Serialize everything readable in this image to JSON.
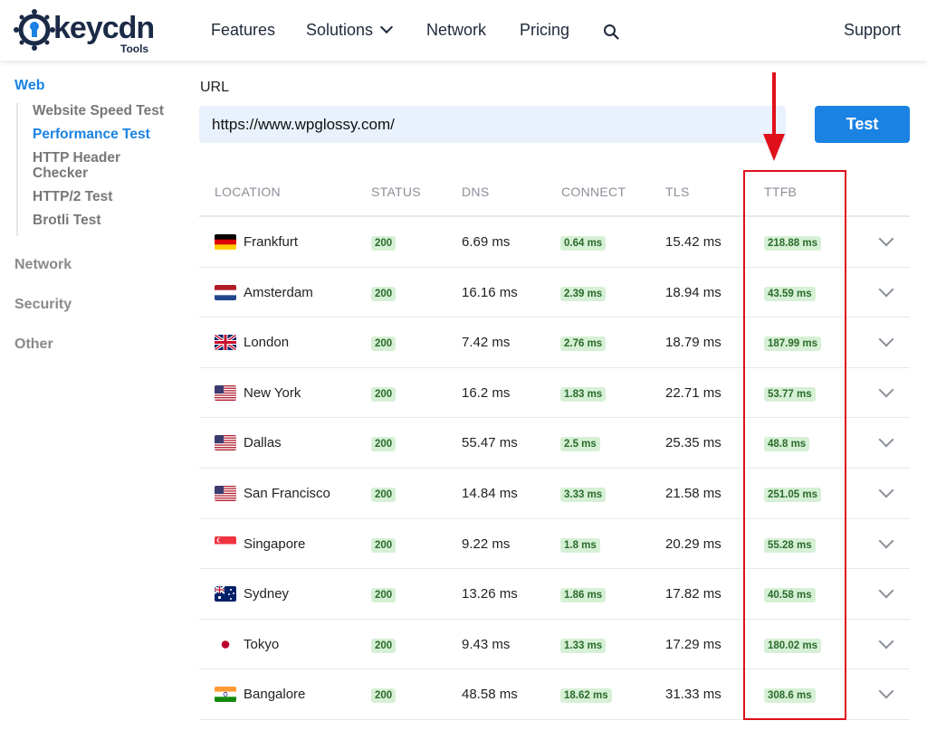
{
  "header": {
    "logo_text": "keycdn",
    "logo_sub": "Tools",
    "nav": {
      "features": "Features",
      "solutions": "Solutions",
      "network": "Network",
      "pricing": "Pricing",
      "support": "Support"
    }
  },
  "sidebar": {
    "web_label": "Web",
    "web_items": [
      {
        "label": "Website Speed Test",
        "active": false
      },
      {
        "label": "Performance Test",
        "active": true
      },
      {
        "label": "HTTP Header Checker",
        "active": false
      },
      {
        "label": "HTTP/2 Test",
        "active": false
      },
      {
        "label": "Brotli Test",
        "active": false
      }
    ],
    "network_label": "Network",
    "security_label": "Security",
    "other_label": "Other"
  },
  "form": {
    "url_label": "URL",
    "url_value": "https://www.wpglossy.com/",
    "test_button": "Test"
  },
  "table": {
    "columns": [
      "LOCATION",
      "STATUS",
      "DNS",
      "CONNECT",
      "TLS",
      "TTFB"
    ],
    "rows": [
      {
        "location": "Frankfurt",
        "flag": "de",
        "status": "200",
        "dns": "6.69 ms",
        "connect": "0.64 ms",
        "tls": "15.42 ms",
        "ttfb": "218.88 ms"
      },
      {
        "location": "Amsterdam",
        "flag": "nl",
        "status": "200",
        "dns": "16.16 ms",
        "connect": "2.39 ms",
        "tls": "18.94 ms",
        "ttfb": "43.59 ms"
      },
      {
        "location": "London",
        "flag": "gb",
        "status": "200",
        "dns": "7.42 ms",
        "connect": "2.76 ms",
        "tls": "18.79 ms",
        "ttfb": "187.99 ms"
      },
      {
        "location": "New York",
        "flag": "us",
        "status": "200",
        "dns": "16.2 ms",
        "connect": "1.83 ms",
        "tls": "22.71 ms",
        "ttfb": "53.77 ms"
      },
      {
        "location": "Dallas",
        "flag": "us",
        "status": "200",
        "dns": "55.47 ms",
        "connect": "2.5 ms",
        "tls": "25.35 ms",
        "ttfb": "48.8 ms"
      },
      {
        "location": "San Francisco",
        "flag": "us",
        "status": "200",
        "dns": "14.84 ms",
        "connect": "3.33 ms",
        "tls": "21.58 ms",
        "ttfb": "251.05 ms"
      },
      {
        "location": "Singapore",
        "flag": "sg",
        "status": "200",
        "dns": "9.22 ms",
        "connect": "1.8 ms",
        "tls": "20.29 ms",
        "ttfb": "55.28 ms"
      },
      {
        "location": "Sydney",
        "flag": "au",
        "status": "200",
        "dns": "13.26 ms",
        "connect": "1.86 ms",
        "tls": "17.82 ms",
        "ttfb": "40.58 ms"
      },
      {
        "location": "Tokyo",
        "flag": "jp",
        "status": "200",
        "dns": "9.43 ms",
        "connect": "1.33 ms",
        "tls": "17.29 ms",
        "ttfb": "180.02 ms"
      },
      {
        "location": "Bangalore",
        "flag": "in",
        "status": "200",
        "dns": "48.58 ms",
        "connect": "18.62 ms",
        "tls": "31.33 ms",
        "ttfb": "308.6 ms"
      }
    ]
  },
  "colors": {
    "accent": "#1a82e2",
    "badge_bg": "#d6f0d5",
    "badge_text": "#2b6b2c",
    "annotation_red": "#e0101a"
  }
}
